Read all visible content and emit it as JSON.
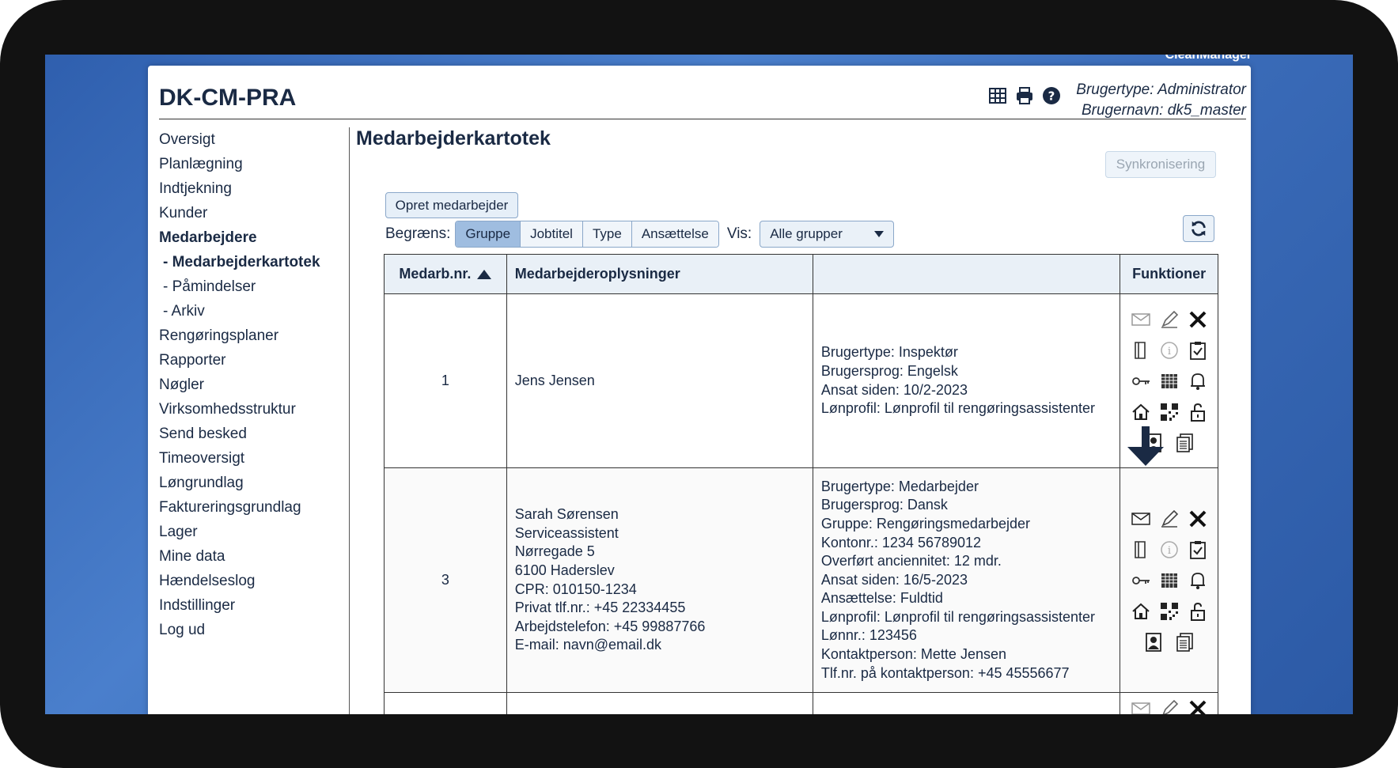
{
  "brand": "CleanManager",
  "app_title": "DK-CM-PRA",
  "user": {
    "type_line": "Brugertype: Administrator",
    "name_line": "Brugernavn: dk5_master"
  },
  "top_icons": [
    "table-icon",
    "print-icon",
    "help-icon"
  ],
  "sidebar": {
    "items": [
      {
        "label": "Oversigt"
      },
      {
        "label": "Planlægning"
      },
      {
        "label": "Indtjekning"
      },
      {
        "label": "Kunder"
      },
      {
        "label": "Medarbejdere"
      },
      {
        "label": "- Medarbejderkartotek"
      },
      {
        "label": "- Påmindelser"
      },
      {
        "label": "- Arkiv"
      },
      {
        "label": "Rengøringsplaner"
      },
      {
        "label": "Rapporter"
      },
      {
        "label": "Nøgler"
      },
      {
        "label": "Virksomhedsstruktur"
      },
      {
        "label": "Send besked"
      },
      {
        "label": "Timeoversigt"
      },
      {
        "label": "Løngrundlag"
      },
      {
        "label": "Faktureringsgrundlag"
      },
      {
        "label": "Lager"
      },
      {
        "label": "Mine data"
      },
      {
        "label": "Hændelseslog"
      },
      {
        "label": "Indstillinger"
      },
      {
        "label": "Log ud"
      }
    ]
  },
  "main": {
    "title": "Medarbejderkartotek",
    "sync_button": "Synkronisering",
    "create_button": "Opret medarbejder",
    "filter_label": "Begræns:",
    "filters": [
      "Gruppe",
      "Jobtitel",
      "Type",
      "Ansættelse"
    ],
    "active_filter": "Gruppe",
    "vis_label": "Vis:",
    "vis_value": "Alle grupper",
    "table": {
      "headers": [
        "Medarb.nr.",
        "Medarbejderoplysninger",
        "",
        "Funktioner"
      ],
      "rows": [
        {
          "nr": "1",
          "info": [
            "Jens Jensen"
          ],
          "details": [
            "Brugertype: Inspektør",
            "Brugersprog: Engelsk",
            "Ansat siden: 10/2-2023",
            "Lønprofil: Lønprofil til rengøringsassistenter"
          ]
        },
        {
          "nr": "3",
          "info": [
            "Sarah Sørensen",
            "Serviceassistent",
            "Nørregade 5",
            "6100 Haderslev",
            "CPR: 010150-1234",
            "Privat tlf.nr.: +45 22334455",
            "Arbejdstelefon: +45 99887766",
            "E-mail: navn@email.dk"
          ],
          "details": [
            "Brugertype: Medarbejder",
            "Brugersprog: Dansk",
            "Gruppe: Rengøringsmedarbejder",
            "Kontonr.: 1234 56789012",
            "Overført anciennitet: 12 mdr.",
            "Ansat siden: 16/5-2023",
            "Ansættelse: Fuldtid",
            "Lønprofil: Lønprofil til rengøringsassistenter",
            "Lønnr.: 123456",
            "Kontaktperson: Mette Jensen",
            "Tlf.nr. på kontaktperson: +45 45556677"
          ]
        }
      ]
    }
  },
  "colors": {
    "text": "#1a2a44",
    "desktop": "#3a6bb8",
    "active_segment": "#9fbde0"
  }
}
